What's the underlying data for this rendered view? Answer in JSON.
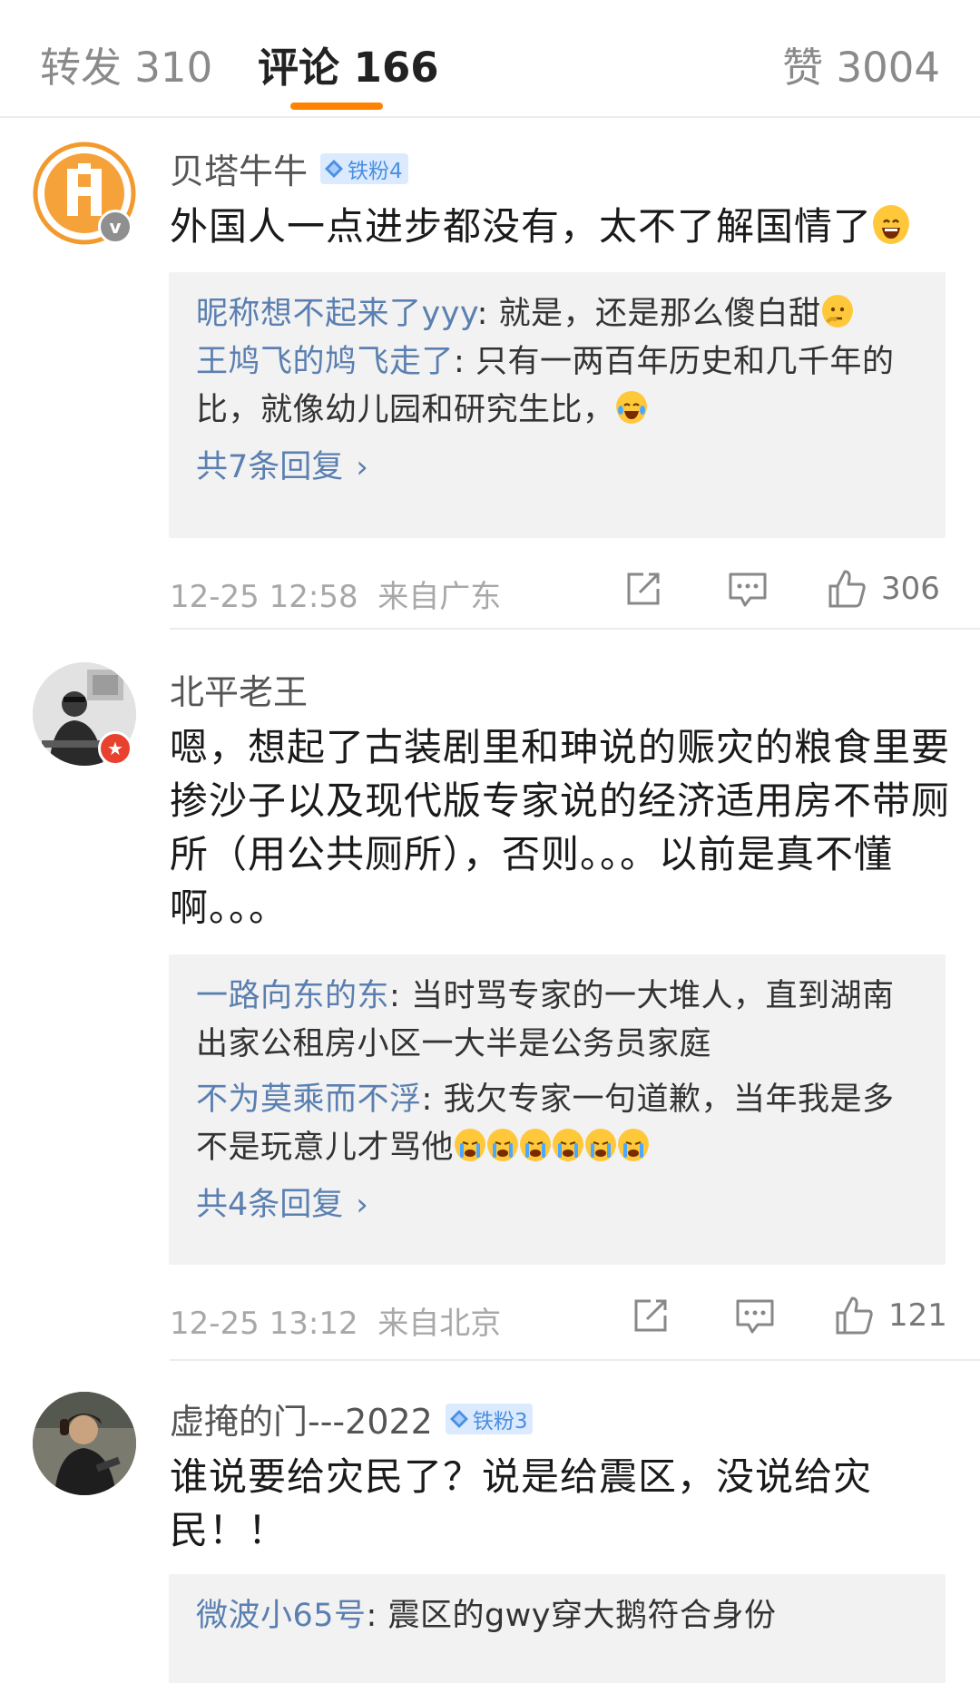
{
  "tabs": {
    "repost": "转发 310",
    "comment": "评论 166",
    "like": "赞 3004",
    "indicator_color": "#ff8200"
  },
  "comments": [
    {
      "user": "贝塔牛牛",
      "fan_badge": "铁粉4",
      "avatar": "avatar-orange-logo",
      "verify": "v-badge-gray",
      "text": "外国人一点进步都没有，太不了解国情了",
      "text_emoji": "laughing-emoji",
      "replies": [
        {
          "name": "昵称想不起来了yyy",
          "sep": ": ",
          "text": "就是，还是那么傻白甜",
          "emoji": "thinking-emoji"
        },
        {
          "name": "王鸠飞的鸠飞走了",
          "sep": ": ",
          "text": "只有一两百年历史和几千年的比，就像幼儿园和研究生比，",
          "emoji": "laugh-cry-emoji"
        }
      ],
      "more": "共7条回复",
      "time": "12-25 12:58",
      "location": "来自广东",
      "likes": "306"
    },
    {
      "user": "北平老王",
      "avatar": "avatar-photo-man",
      "verify": "star-badge-red",
      "text": "嗯，想起了古装剧里和珅说的赈灾的粮食里要掺沙子以及现代版专家说的经济适用房不带厕所（用公共厕所），否则。。。以前是真不懂啊。。。",
      "replies": [
        {
          "name": "一路向东的东",
          "sep": ": ",
          "text": "当时骂专家的一大堆人，直到湖南出家公租房小区一大半是公务员家庭"
        },
        {
          "name": "不为莫乘而不浮",
          "sep": ": ",
          "text": "我欠专家一句道歉，当年我是多不是玩意儿才骂他",
          "emoji_repeat": 6,
          "emoji": "crying-emoji"
        }
      ],
      "more": "共4条回复",
      "time": "12-25 13:12",
      "location": "来自北京",
      "likes": "121"
    },
    {
      "user": "虚掩的门---2022",
      "fan_badge": "铁粉3",
      "avatar": "avatar-photo-woman",
      "text": "谁说要给灾民了？说是给震区，没说给灾民！！",
      "replies": [
        {
          "name": "微波小65号",
          "sep": ": ",
          "text": "震区的gwy穿大鹅符合身份"
        }
      ]
    }
  ]
}
